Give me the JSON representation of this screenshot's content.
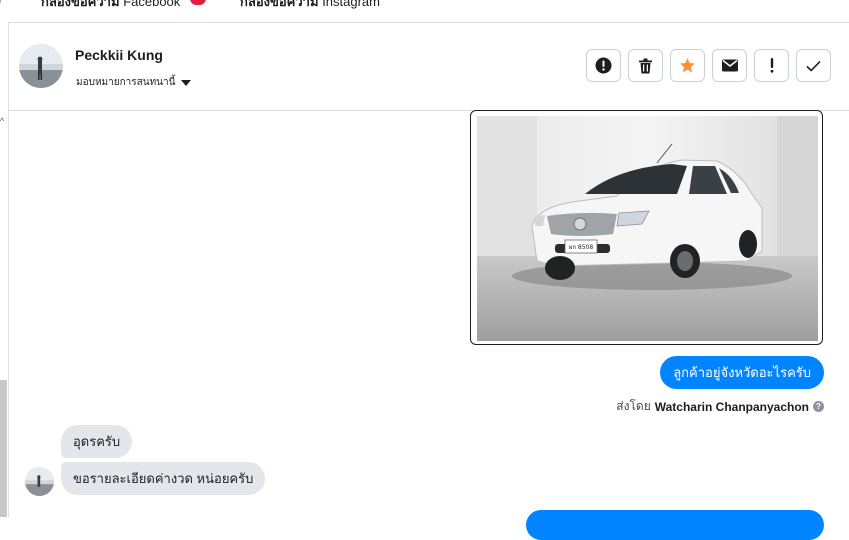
{
  "tabs": [
    {
      "bold": "กล่องข้อความ",
      "thin": "Facebook"
    },
    {
      "bold": "กล่องข้อความ",
      "thin": "Instagram"
    }
  ],
  "contact": {
    "name": "Peckkii Kung",
    "assign_label": "มอบหมายการสนทนานี้"
  },
  "actions": [
    {
      "name": "spam-button",
      "icon": "alert-circle-icon"
    },
    {
      "name": "delete-button",
      "icon": "trash-icon"
    },
    {
      "name": "star-button",
      "icon": "star-icon",
      "color": "#f7923b"
    },
    {
      "name": "mark-unread-button",
      "icon": "envelope-icon"
    },
    {
      "name": "follow-up-button",
      "icon": "exclamation-icon"
    },
    {
      "name": "mark-done-button",
      "icon": "check-icon"
    }
  ],
  "messages": {
    "outgoing_image": {
      "alt": "รถยนต์สีขาว",
      "plate": "ผก 8508"
    },
    "outgoing_text": "ลูกค้าอยู่จังหวัดอะไรครับ",
    "sent_by_prefix": "ส่งโดย",
    "sent_by_name": "Watcharin Chanpanyachon",
    "incoming": [
      "อุดรครับ",
      "ขอรายละเอียดค่างวด หน่อยครับ"
    ]
  },
  "colors": {
    "accent": "#0084ff",
    "incoming_bubble": "#e4e6eb",
    "badge": "#e41e3f",
    "star": "#f7923b"
  }
}
